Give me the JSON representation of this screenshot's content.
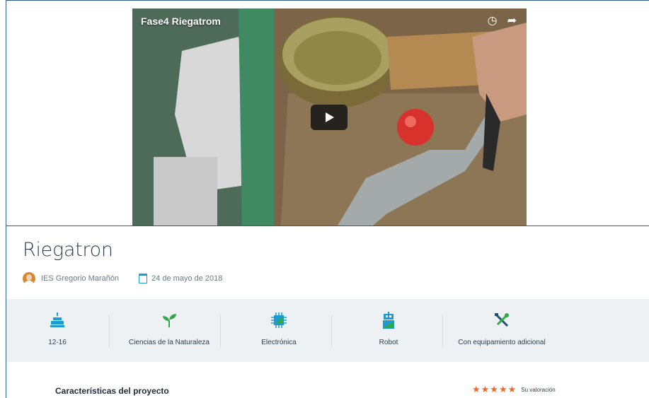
{
  "video": {
    "title": "Fase4 Riegatrom",
    "icons": [
      "clock-icon",
      "share-icon"
    ]
  },
  "project": {
    "title": "Riegatron",
    "author": "IES Gregorio Marañón",
    "date": "24 de mayo de 2018"
  },
  "tags": [
    {
      "label": "12-16",
      "icon": "cake-icon"
    },
    {
      "label": "Ciencias de la Naturaleza",
      "icon": "sprout-icon"
    },
    {
      "label": "Electrónica",
      "icon": "chip-icon"
    },
    {
      "label": "Robot",
      "icon": "robot-icon"
    },
    {
      "label": "Con equipamiento adicional",
      "icon": "tools-icon"
    }
  ],
  "section": {
    "heading": "Características del proyecto"
  },
  "rating": {
    "stars": "★★★★★",
    "label": "Su valoración"
  },
  "colors": {
    "accent": "#1b9bd1",
    "stars": "#ee6a2a",
    "title": "#2b3f52",
    "tags_bg": "#eef1f3"
  }
}
